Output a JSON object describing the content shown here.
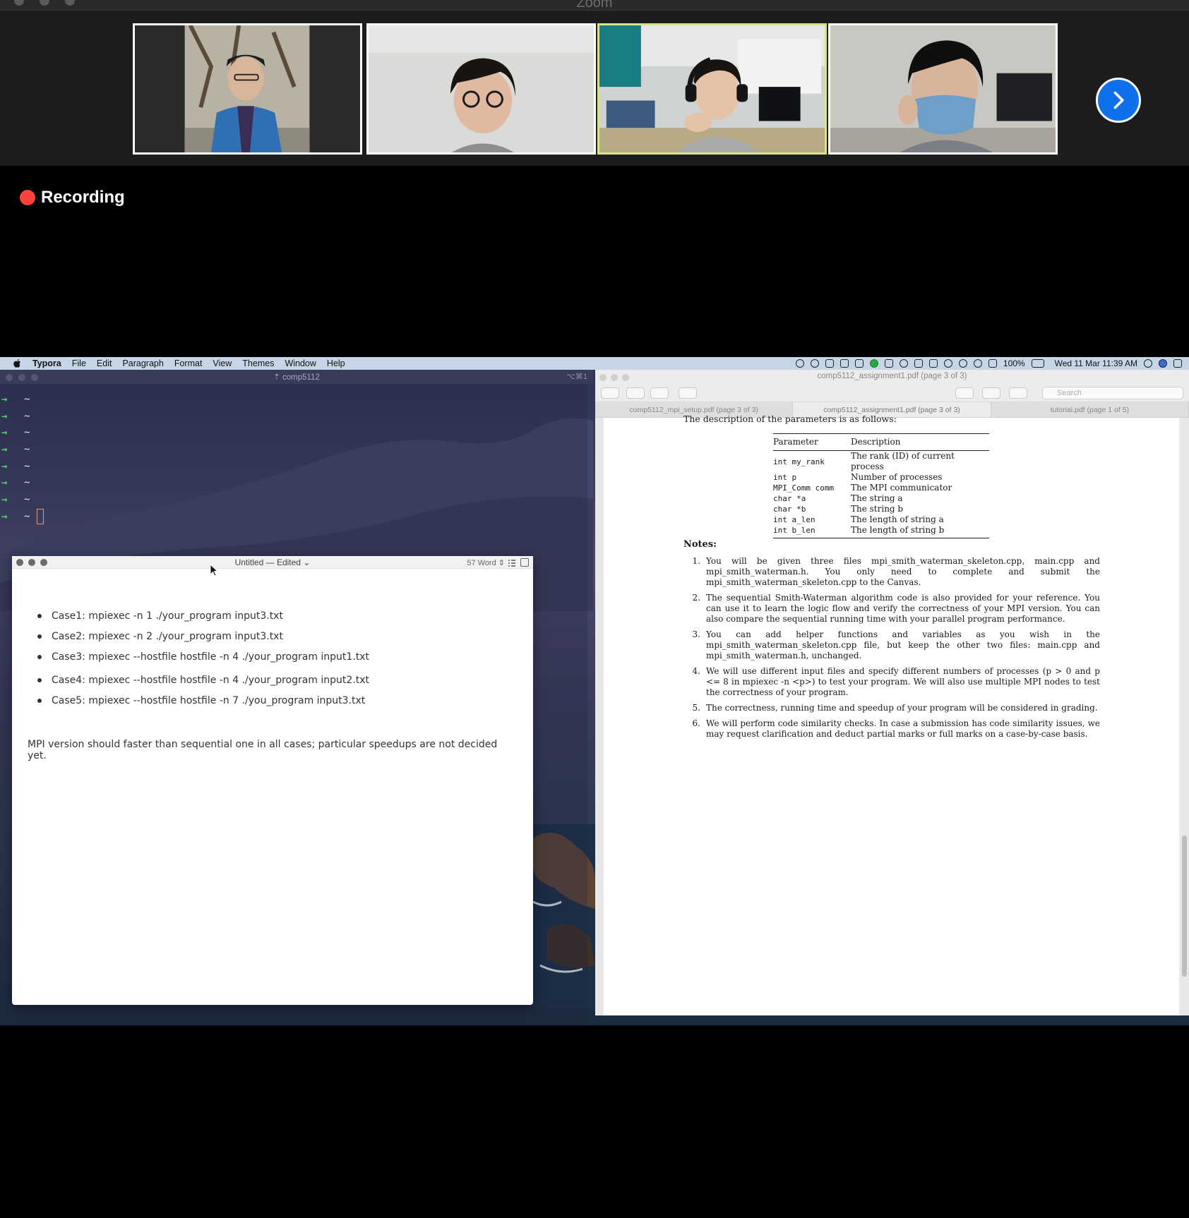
{
  "zoom": {
    "title": "Zoom",
    "recording_label": "Recording"
  },
  "menubar": {
    "app_name": "Typora",
    "items": [
      "File",
      "Edit",
      "Paragraph",
      "Format",
      "View",
      "Themes",
      "Window",
      "Help"
    ],
    "battery": "100%",
    "datetime": "Wed 11 Mar  11:39 AM"
  },
  "terminal": {
    "title": "comp5112",
    "shortcut": "⌥⌘1",
    "prompt_char": "~",
    "line_count": 8
  },
  "typora": {
    "title": "Untitled — Edited",
    "word_count": "57 Word",
    "bullets": [
      "Case1: mpiexec -n 1 ./your_program input3.txt",
      "Case2: mpiexec -n 2 ./your_program input3.txt",
      "Case3: mpiexec --hostfile hostfile -n 4 ./your_program input1.txt",
      "Case4: mpiexec --hostfile hostfile -n 4 ./your_program input2.txt",
      "Case5: mpiexec --hostfile hostfile -n 7 ./you_program input3.txt"
    ],
    "note": "MPI version should faster than sequential one in all cases; particular speedups are not decided yet."
  },
  "preview": {
    "title": "comp5112_assignment1.pdf (page 3 of 3)",
    "search_placeholder": "Search",
    "tabs": [
      "comp5112_mpi_setup.pdf (page 3 of 3)",
      "comp5112_assignment1.pdf (page 3 of 3)",
      "tutorial.pdf (page 1 of 5)"
    ]
  },
  "pdf": {
    "intro": "The description of the parameters is as follows:",
    "table_headers": [
      "Parameter",
      "Description"
    ],
    "table_rows": [
      [
        "int my_rank",
        "The rank (ID) of current process"
      ],
      [
        "int p",
        "Number of processes"
      ],
      [
        "MPI_Comm comm",
        "The MPI communicator"
      ],
      [
        "char *a",
        "The string a"
      ],
      [
        "char *b",
        "The string b"
      ],
      [
        "int a_len",
        "The length of string a"
      ],
      [
        "int b_len",
        "The length of string b"
      ]
    ],
    "notes_heading": "Notes:",
    "notes": [
      "You will be given three files mpi_smith_waterman_skeleton.cpp, main.cpp and mpi_smith_waterman.h. You only need to complete and submit the mpi_smith_waterman_skeleton.cpp to the Canvas.",
      "The sequential Smith-Waterman algorithm code is also provided for your reference. You can use it to learn the logic flow and verify the correctness of your MPI version. You can also compare the sequential running time with your parallel program performance.",
      "You can add helper functions and variables as you wish in the mpi_smith_waterman_skeleton.cpp file, but keep the other two files: main.cpp and mpi_smith_waterman.h, unchanged.",
      "We will use different input files and specify different numbers of processes (p > 0 and p <= 8 in mpiexec -n <p>) to test your program. We will also use multiple MPI nodes to test the correctness of your program.",
      "The correctness, running time and speedup of your program will be considered in grading.",
      "We will perform code similarity checks. In case a submission has code similarity issues, we may request clarification and deduct partial marks or full marks on a case-by-case basis."
    ]
  },
  "colors": {
    "recording_dot": "#ff453a",
    "active_speaker_border": "#d9e38a",
    "next_button": "#0e71eb",
    "terminal_arrow": "#4cd964"
  }
}
